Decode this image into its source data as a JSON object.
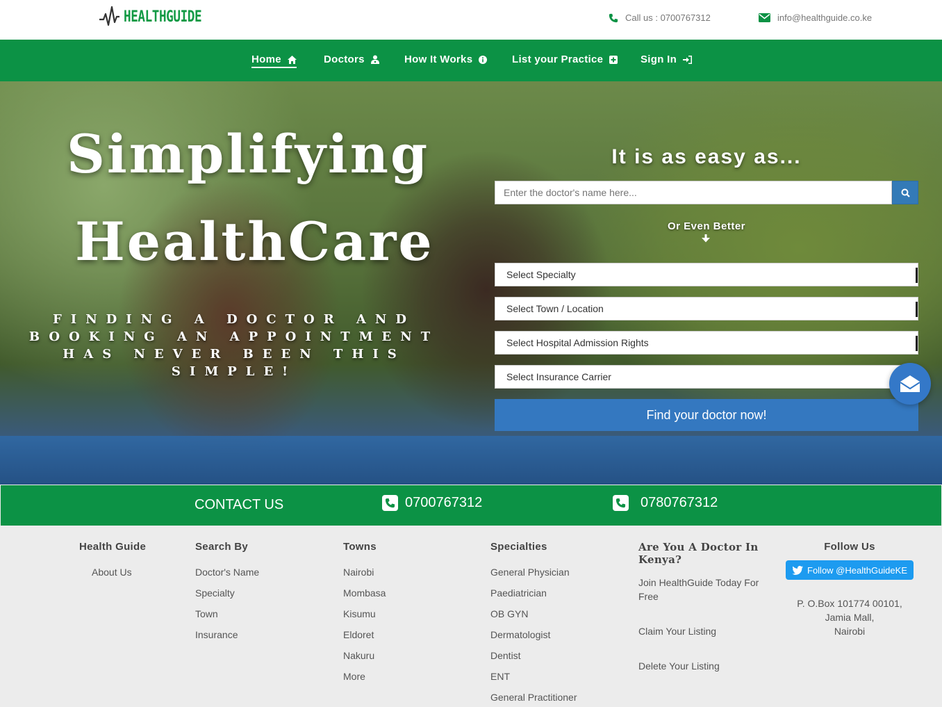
{
  "header": {
    "logo_text": "HEALTHGUIDE",
    "phone": "Call us : 0700767312",
    "email": "info@healthguide.co.ke"
  },
  "nav": {
    "items": [
      {
        "label": "Home",
        "icon": "home-icon",
        "active": true
      },
      {
        "label": "Doctors",
        "icon": "user-md-icon"
      },
      {
        "label": "How It Works",
        "icon": "info-circle-icon"
      },
      {
        "label": "List your Practice",
        "icon": "plus-square-icon"
      },
      {
        "label": "Sign In",
        "icon": "sign-in-icon"
      }
    ]
  },
  "hero": {
    "title_line1": "Simplifying",
    "title_line2": "HealthCare",
    "subtitle": "FINDING A DOCTOR AND BOOKING AN APPOINTMENT HAS NEVER BEEN THIS SIMPLE!",
    "easy_heading": "It is as easy as...",
    "search_placeholder": "Enter the doctor's name here...",
    "or_better": "Or Even Better",
    "selects": [
      "Select Specialty",
      "Select Town / Location",
      "Select Hospital Admission Rights",
      "Select Insurance Carrier"
    ],
    "find_button": "Find your doctor now!"
  },
  "contact_strip": {
    "label": "CONTACT US",
    "phone1": "0700767312",
    "phone2": "0780767312"
  },
  "footer": {
    "health_guide": {
      "heading": "Health Guide",
      "links": [
        "About Us"
      ]
    },
    "search_by": {
      "heading": "Search By",
      "links": [
        "Doctor's Name",
        "Specialty",
        "Town",
        "Insurance"
      ]
    },
    "towns": {
      "heading": "Towns",
      "links": [
        "Nairobi",
        "Mombasa",
        "Kisumu",
        "Eldoret",
        "Nakuru",
        "More"
      ]
    },
    "specialties": {
      "heading": "Specialties",
      "links": [
        "General Physician",
        "Paediatrician",
        "OB GYN",
        "Dermatologist",
        "Dentist",
        "ENT",
        "General Practitioner"
      ]
    },
    "doctor": {
      "heading": "Are You A Doctor In Kenya?",
      "links": [
        "Join HealthGuide Today For Free",
        "Claim Your Listing",
        "Delete Your Listing"
      ]
    },
    "follow": {
      "heading": "Follow Us",
      "twitter": "Follow @HealthGuideKE",
      "address1": "P. O.Box 101774 00101,",
      "address2": "Jamia Mall,",
      "address3": "Nairobi"
    }
  },
  "colors": {
    "green": "#0c9245",
    "blue": "#3478c0",
    "twitter": "#1d9bf0"
  }
}
